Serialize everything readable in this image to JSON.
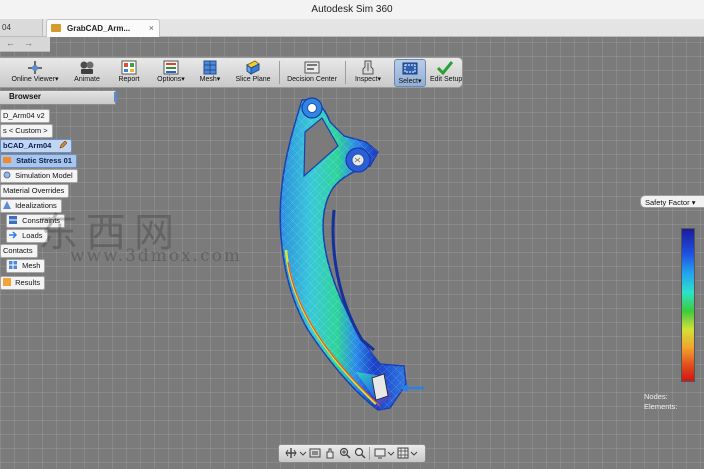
{
  "window": {
    "title": "Autodesk Sim 360"
  },
  "tabs": {
    "previous": "04",
    "active": "GrabCAD_Arm...",
    "close_glyph": "×"
  },
  "nav_back": "←",
  "nav_forward": "→",
  "toolbar": {
    "online_viewer": "Online Viewer",
    "animate": "Animate",
    "report": "Report",
    "options": "Options",
    "mesh": "Mesh",
    "slice_plane": "Slice Plane",
    "decision_center": "Decision Center",
    "inspect": "Inspect",
    "select": "Select",
    "edit_setup": "Edit Setup",
    "dropdown_glyph": "▾"
  },
  "browser": {
    "title": "Browser",
    "nodes": [
      "D_Arm04 v2",
      "s < Custom >",
      "bCAD_Arm04",
      "Static Stress 01",
      "Simulation Model",
      "Material Overrides",
      "Idealizations",
      "Constraints",
      "Loads",
      "Contacts",
      "Mesh",
      "Results"
    ]
  },
  "watermark": {
    "main": "东西网",
    "url": "www.3dmox.com"
  },
  "results_legend": {
    "dropdown_label": "Safety Factor",
    "dropdown_glyph": "▾",
    "nodes_label": "Nodes:",
    "elements_label": "Elements:",
    "colors": [
      "#1d1d9a",
      "#1f4fe0",
      "#22a8f0",
      "#2ee2c8",
      "#3ccb3c",
      "#d2e03a",
      "#f2a52a",
      "#e04b1c",
      "#d11616"
    ]
  },
  "colors": {
    "accent_blue": "#5c8ad0",
    "load_arrow": "#2a7fe8",
    "selected_node": "#a8c5ec"
  }
}
